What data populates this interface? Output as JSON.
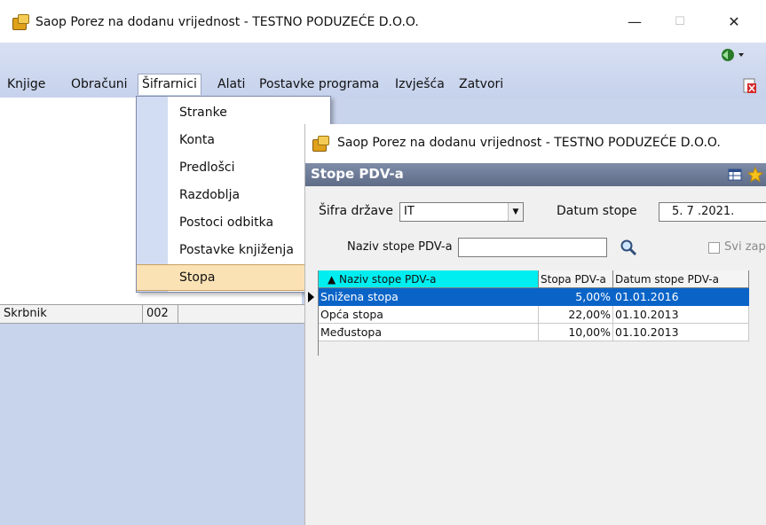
{
  "window": {
    "title": "Saop Porez na dodanu vrijednost - TESTNO PODUZEĆE D.O.O.",
    "controls": {
      "minimize": "—",
      "maximize": "☐",
      "close": "✕"
    }
  },
  "menubar": {
    "items": [
      {
        "label": "Knjige"
      },
      {
        "label": "Obračuni"
      },
      {
        "label": "Šifrarnici"
      },
      {
        "label": "Alati"
      },
      {
        "label": "Postavke programa"
      },
      {
        "label": "Izvješća"
      },
      {
        "label": "Zatvori"
      }
    ],
    "active": "Šifrarnici"
  },
  "dropdown": {
    "items": [
      {
        "label": "Stranke"
      },
      {
        "label": "Konta"
      },
      {
        "label": "Predlošci"
      },
      {
        "label": "Razdoblja"
      },
      {
        "label": "Postoci odbitka"
      },
      {
        "label": "Postavke knjiženja"
      },
      {
        "label": "Stopa"
      }
    ],
    "highlighted": "Stopa"
  },
  "statusbar": {
    "label": "Skrbnik",
    "value": "002"
  },
  "dialog": {
    "title": "Saop Porez na dodanu vrijednost - TESTNO PODUZEĆE D.O.O.",
    "header": "Stope PDV-a",
    "sifra_drzave_label": "Šifra države",
    "sifra_drzave_value": "IT",
    "datum_stope_label": "Datum stope",
    "datum_stope_value": "5. 7 .2021.",
    "naziv_label": "Naziv stope PDV-a",
    "naziv_value": "",
    "svi_label": "Svi zap",
    "grid": {
      "columns": [
        "▲ Naziv stope PDV-a",
        "Stopa PDV-a",
        "Datum stope PDV-a"
      ],
      "rows": [
        {
          "naziv": "Snižena stopa",
          "stopa": "5,00%",
          "datum": "01.01.2016"
        },
        {
          "naziv": "Opća stopa",
          "stopa": "22,00%",
          "datum": "01.10.2013"
        },
        {
          "naziv": "Međustopa",
          "stopa": "10,00%",
          "datum": "01.10.2013"
        }
      ],
      "selected_row": 0
    }
  },
  "colors": {
    "accent_selection": "#0a64c8",
    "header_cyan": "#00eef0",
    "menu_highlight": "#fbe2b5",
    "dialog_header": "#6f7c98"
  }
}
